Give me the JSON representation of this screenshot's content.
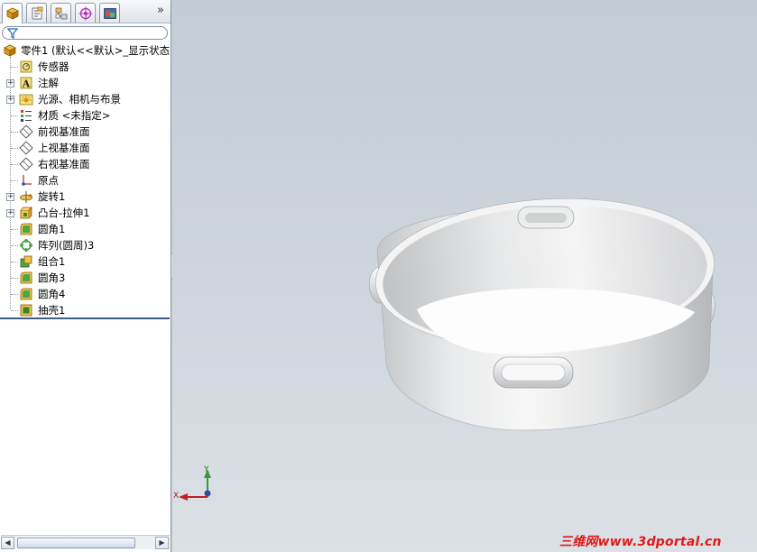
{
  "panel": {
    "tabs": [
      {
        "name": "feature-manager-tab",
        "icon": "feature-manager-icon",
        "active": true
      },
      {
        "name": "property-manager-tab",
        "icon": "property-manager-icon",
        "active": false
      },
      {
        "name": "configuration-manager-tab",
        "icon": "configuration-manager-icon",
        "active": false
      },
      {
        "name": "dimxpert-manager-tab",
        "icon": "target-icon",
        "active": false
      },
      {
        "name": "display-manager-tab",
        "icon": "display-manager-icon",
        "active": false
      }
    ],
    "expand_glyph": "»",
    "tree": {
      "root": "零件1   (默认<<默认>_显示状态",
      "items": [
        {
          "label": "传感器",
          "icon": "sensor-icon",
          "expandable": false
        },
        {
          "label": "注解",
          "icon": "annotation-icon",
          "expandable": true
        },
        {
          "label": "光源、相机与布景",
          "icon": "lights-icon",
          "expandable": true
        },
        {
          "label": "材质 <未指定>",
          "icon": "material-icon",
          "expandable": false
        },
        {
          "label": "前视基准面",
          "icon": "plane-icon",
          "expandable": false
        },
        {
          "label": "上视基准面",
          "icon": "plane-icon",
          "expandable": false
        },
        {
          "label": "右视基准面",
          "icon": "plane-icon",
          "expandable": false
        },
        {
          "label": "原点",
          "icon": "origin-icon",
          "expandable": false
        },
        {
          "label": "旋转1",
          "icon": "revolve-icon",
          "expandable": true
        },
        {
          "label": "凸台-拉伸1",
          "icon": "extrude-icon",
          "expandable": true
        },
        {
          "label": "圆角1",
          "icon": "fillet-icon",
          "expandable": false
        },
        {
          "label": "阵列(圆周)3",
          "icon": "circular-pattern-icon",
          "expandable": false
        },
        {
          "label": "组合1",
          "icon": "combine-icon",
          "expandable": false
        },
        {
          "label": "圆角3",
          "icon": "fillet-icon",
          "expandable": false
        },
        {
          "label": "圆角4",
          "icon": "fillet-icon",
          "expandable": false
        },
        {
          "label": "抽壳1",
          "icon": "shell-icon",
          "expandable": false
        }
      ]
    }
  },
  "viewport": {
    "triad": {
      "x_label": "X",
      "y_label": "Y"
    },
    "watermark": "三维网www.3dportal.cn"
  },
  "colors": {
    "viewport_top": "#c3ccd5",
    "viewport_bottom": "#dce1e6",
    "watermark": "#e01818",
    "rollback_bar": "#3d5d8a"
  }
}
